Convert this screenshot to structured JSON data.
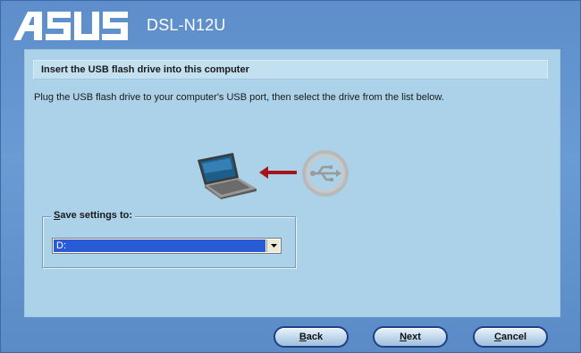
{
  "header": {
    "logo_text": "ASUS",
    "product": "DSL-N12U"
  },
  "panel": {
    "heading": "Insert the USB flash drive into this computer",
    "instruction": "Plug the USB flash drive to your computer's USB port, then select the drive from the list below."
  },
  "illustration": {
    "laptop_icon": "laptop-icon",
    "arrow_icon": "arrow-left-icon",
    "usb_icon": "usb-icon",
    "arrow_color": "#a8141c"
  },
  "save_settings": {
    "label_first": "S",
    "label_rest": "ave settings to:",
    "selected_drive": "D:"
  },
  "buttons": {
    "back_first": "B",
    "back_rest": "ack",
    "next_first": "N",
    "next_rest": "ext",
    "cancel_first": "C",
    "cancel_rest": "ancel"
  },
  "colors": {
    "window_bg": "#5f8fc9",
    "panel_bg": "#abd2e8",
    "selection": "#2a5bd7"
  }
}
